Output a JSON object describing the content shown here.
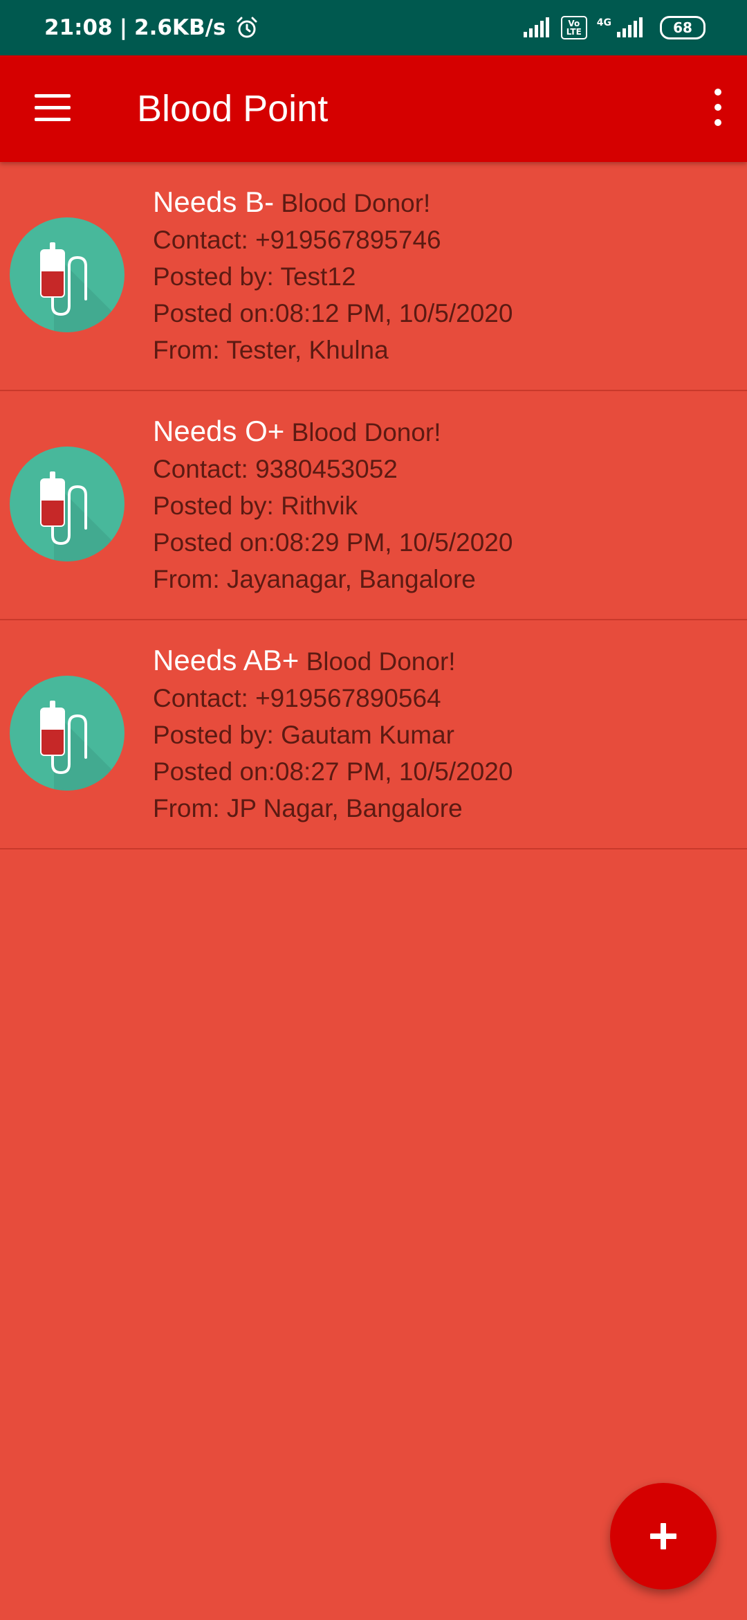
{
  "status_bar": {
    "time": "21:08",
    "separator": "|",
    "speed": "2.6KB/s",
    "volte_top": "Vo",
    "volte_bottom": "LTE",
    "network": "4G",
    "battery": "68",
    "icons": [
      "alarm-icon",
      "signal-icon",
      "volte-icon",
      "signal-icon",
      "battery-icon"
    ]
  },
  "app_bar": {
    "title": "Blood Point",
    "menu_icon": "hamburger-menu-icon",
    "more_icon": "more-vert-icon",
    "color": "#D50000"
  },
  "requests": [
    {
      "needs": "Needs B-",
      "suffix": "Blood Donor!",
      "contact": "Contact: +919567895746",
      "posted_by": "Posted by: Test12",
      "posted_on": "Posted on:08:12 PM, 10/5/2020",
      "from": "From: Tester, Khulna"
    },
    {
      "needs": "Needs O+",
      "suffix": "Blood Donor!",
      "contact": "Contact: 9380453052",
      "posted_by": "Posted by: Rithvik",
      "posted_on": "Posted on:08:29 PM, 10/5/2020",
      "from": "From: Jayanagar, Bangalore"
    },
    {
      "needs": "Needs AB+",
      "suffix": "Blood Donor!",
      "contact": "Contact: +919567890564",
      "posted_by": "Posted by: Gautam Kumar",
      "posted_on": "Posted on:08:27 PM, 10/5/2020",
      "from": "From: JP Nagar, Bangalore"
    }
  ],
  "fab": {
    "icon": "plus-icon"
  },
  "colors": {
    "status_bar": "#00594F",
    "background": "#E74C3C",
    "avatar": "#48B89B",
    "text": "#5C1A12"
  }
}
